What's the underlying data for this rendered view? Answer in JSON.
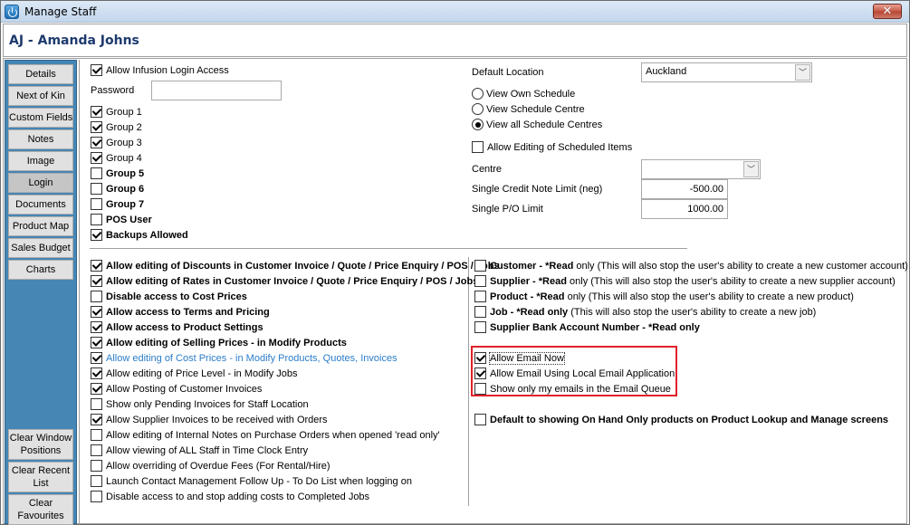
{
  "window": {
    "title": "Manage Staff",
    "close_icon": "close-x-icon",
    "app_icon": "power-icon"
  },
  "header": {
    "staff_name": "AJ - Amanda Johns"
  },
  "sidebar": {
    "items": [
      {
        "label": "Details",
        "active": false
      },
      {
        "label": "Next of Kin",
        "active": false
      },
      {
        "label": "Custom Fields",
        "active": false
      },
      {
        "label": "Notes",
        "active": false
      },
      {
        "label": "Image",
        "active": false
      },
      {
        "label": "Login",
        "active": true
      },
      {
        "label": "Documents",
        "active": false
      },
      {
        "label": "Product Map",
        "active": false
      },
      {
        "label": "Sales Budget",
        "active": false
      },
      {
        "label": "Charts",
        "active": false
      }
    ],
    "bottom_items": [
      {
        "label": "Clear Window Positions"
      },
      {
        "label": "Clear Recent List"
      },
      {
        "label": "Clear Favourites"
      }
    ]
  },
  "login": {
    "allow_login": {
      "label": "Allow Infusion Login Access",
      "checked": true
    },
    "password_label": "Password",
    "password_value": "",
    "groups": [
      {
        "label": "Group 1",
        "checked": true
      },
      {
        "label": "Group 2",
        "checked": true
      },
      {
        "label": "Group 3",
        "checked": true
      },
      {
        "label": "Group 4",
        "checked": true
      },
      {
        "label": "Group 5",
        "checked": false
      },
      {
        "label": "Group 6",
        "checked": false
      },
      {
        "label": "Group 7",
        "checked": false
      },
      {
        "label": "POS User",
        "checked": false
      },
      {
        "label": "Backups Allowed",
        "checked": true
      }
    ],
    "default_location_label": "Default Location",
    "default_location_value": "Auckland",
    "schedule_options": [
      {
        "label": "View Own Schedule",
        "selected": false
      },
      {
        "label": "View Schedule Centre",
        "selected": false
      },
      {
        "label": "View all Schedule Centres",
        "selected": true
      }
    ],
    "allow_editing_scheduled": {
      "label": "Allow Editing of Scheduled Items",
      "checked": false
    },
    "centre_label": "Centre",
    "centre_value": "",
    "credit_note_label": "Single Credit Note Limit (neg)",
    "credit_note_value": "-500.00",
    "po_limit_label": "Single P/O Limit",
    "po_limit_value": "1000.00"
  },
  "permissions_left": [
    {
      "label": "Allow editing of Discounts in Customer Invoice / Quote / Price Enquiry / POS / Jobs",
      "checked": true,
      "style": "bold"
    },
    {
      "label": "Allow editing of Rates in Customer Invoice / Quote / Price Enquiry / POS / Jobs",
      "checked": true,
      "style": "bold"
    },
    {
      "label": "Disable access to Cost Prices",
      "checked": false,
      "style": "bold"
    },
    {
      "label": "Allow access to Terms and Pricing",
      "checked": true,
      "style": "bold"
    },
    {
      "label": "Allow access to Product Settings",
      "checked": true,
      "style": "bold"
    },
    {
      "label": "Allow editing of Selling Prices - in Modify Products",
      "checked": true,
      "style": "bold"
    },
    {
      "label": "Allow editing of Cost Prices - in Modify Products, Quotes, Invoices",
      "checked": true,
      "style": "blue"
    },
    {
      "label": "Allow editing of Price Level - in Modify Jobs",
      "checked": true,
      "style": "normal"
    },
    {
      "label": "Allow Posting of Customer Invoices",
      "checked": true,
      "style": "normal"
    },
    {
      "label": "Show only Pending Invoices for Staff Location",
      "checked": false,
      "style": "normal"
    },
    {
      "label": "Allow Supplier Invoices to be received with Orders",
      "checked": true,
      "style": "normal"
    },
    {
      "label": "Allow editing of Internal Notes on Purchase Orders when opened 'read only'",
      "checked": false,
      "style": "normal"
    },
    {
      "label": "Allow viewing of ALL Staff in Time Clock Entry",
      "checked": false,
      "style": "normal"
    },
    {
      "label": "Allow overriding of Overdue Fees (For Rental/Hire)",
      "checked": false,
      "style": "normal"
    },
    {
      "label": "Launch Contact Management Follow Up - To Do List when logging on",
      "checked": false,
      "style": "normal"
    },
    {
      "label": "Disable access to and stop adding costs to Completed Jobs",
      "checked": false,
      "style": "normal"
    }
  ],
  "permissions_right": [
    {
      "bold": "Customer - *Read",
      "rest": " only (This will also stop the user's ability to create a new customer account)",
      "checked": false
    },
    {
      "bold": "Supplier - *Read",
      "rest": " only (This will also stop the user's ability to create a new supplier account)",
      "checked": false
    },
    {
      "bold": "Product - *Read",
      "rest": " only (This will also stop the user's ability to create a new product)",
      "checked": false
    },
    {
      "bold": "Job - *Read only",
      "rest": " (This will also stop the user's ability to create a new job)",
      "checked": false
    },
    {
      "bold": "Supplier Bank Account Number - *Read only",
      "rest": "",
      "checked": false
    }
  ],
  "email_options": [
    {
      "label": "Allow Email Now",
      "checked": true
    },
    {
      "label": "Allow Email Using Local Email Application",
      "checked": true
    },
    {
      "label": "Show only my emails in the Email Queue",
      "checked": false
    }
  ],
  "on_hand_default": {
    "label": "Default to showing On Hand Only products on Product Lookup and Manage screens",
    "checked": false
  },
  "colors": {
    "sidebar_bg": "#4686b4",
    "highlight_border": "#e0202a",
    "link_blue": "#2b7cc8",
    "header_text": "#1e3a6e"
  }
}
